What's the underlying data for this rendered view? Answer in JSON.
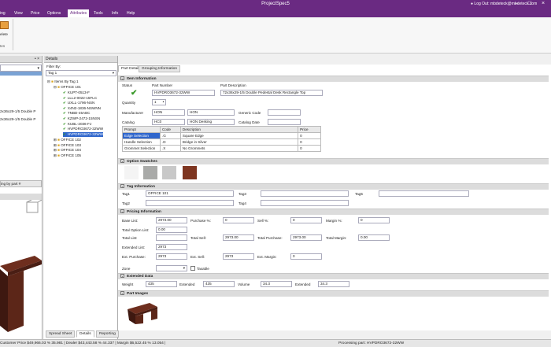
{
  "window": {
    "title": "ProjectSpec5",
    "user": "Log Out: mbdeteck@mbdeteck.com"
  },
  "menu": [
    "ing",
    "View",
    "Price",
    "Options",
    "Attributes",
    "Tools",
    "Info",
    "Help"
  ],
  "ribbon": {
    "button_label": "elete",
    "group_label": "tes"
  },
  "left": {
    "tree_items": [
      "2x36x29-1/5 Double P",
      "2x36x29-1/5 Double P"
    ],
    "group_by": "ing by part #"
  },
  "details": {
    "label": "Details",
    "filter_label": "Filter By:",
    "filter_value": "Tag 1"
  },
  "tree": {
    "root": "Items By Tag 1",
    "office101": "OFFICE 101",
    "parts": [
      "KUPT-0513-F",
      "LLL2-0022-15FLC",
      "UXLL-1796-NSN",
      "X4N2-1836-NSWNN",
      "TNBD-45ABC",
      "KZWP-2472-15NSN",
      "KUBL-2036-FJ",
      "HVPDRO3672-32WW",
      "HVPDRO3672-32WW"
    ],
    "offices": [
      "OFFICE 102",
      "OFFICE 103",
      "OFFICE 104",
      "OFFICE 105"
    ]
  },
  "tabs": [
    "Part Details",
    "Grouping Information"
  ],
  "item_info": {
    "section": "Item Information",
    "status_label": "Status",
    "part_number_label": "Part Number",
    "part_description_label": "Part Description",
    "part_number": "HVPDRO3672-32WW",
    "part_description": "72x36x29-1/5 Double Pedestal Desk  Rectangle Top",
    "quantity_label": "Quantity",
    "quantity": "1",
    "manufacturer_label": "Manufacturer",
    "manufacturer_code": "HON",
    "manufacturer_name": "HON",
    "generic_code_label": "Generic Code",
    "catalog_label": "Catalog",
    "catalog_code": "HC0",
    "catalog_name": "HON Desking",
    "catalog_date_label": "Catalog Date"
  },
  "prompts": {
    "headers": [
      "Prompt",
      "Code",
      "Description",
      "Price"
    ],
    "rows": [
      [
        "Edge Selection",
        ".G",
        "Square Edge",
        "0"
      ],
      [
        "Handle Selection",
        ".D",
        "Bridge in Silver",
        "0"
      ],
      [
        "Grommet Selection",
        ".X",
        "No Grommets",
        "0"
      ]
    ]
  },
  "option_swatches": {
    "section": "Option Swatches",
    "colors": [
      "#f4f4f4",
      "#a9aaa8",
      "#c8c8c8",
      "#7e3520"
    ]
  },
  "tag_info": {
    "section": "Tag Information",
    "tag1_label": "Tag1",
    "tag1": "OFFICE 101",
    "tag2_label": "Tag2",
    "tag3_label": "Tag3",
    "tag4_label": "Tag4",
    "tag5_label": "Tag5"
  },
  "pricing": {
    "section": "Pricing Information",
    "base_list_label": "Base List:",
    "base_list": "2973.00",
    "purchase_pct_label": "Purchase %:",
    "purchase_pct": "0",
    "sell_pct_label": "Sell %:",
    "sell_pct": "0",
    "margin_pct_label": "Margin %:",
    "margin_pct": "0",
    "total_option_list_label": "Total Option List:",
    "total_option_list": "0.00",
    "total_list_label": "Total List:",
    "total_sell_label": "Total Sell:",
    "total_sell": "2973.00",
    "total_purchase_label": "Total Purchase:",
    "total_purchase": "2973.00",
    "total_margin_label": "Total Margin:",
    "total_margin": "0.00",
    "extended_list_label": "Extended List:",
    "extended_list": "2973",
    "ext_purchase_label": "Ext. Purchase:",
    "ext_purchase": "2973",
    "ext_sell_label": "Ext. Sell:",
    "ext_sell": "2973",
    "ext_margin_label": "Ext. Margin:",
    "ext_margin": "0",
    "zone_label": "Zone",
    "taxable_label": "Taxable"
  },
  "extended_data": {
    "section": "Extended Data",
    "weight_label": "Weight",
    "weight": "435",
    "extended1_label": "Extended",
    "extended1": "435",
    "volume_label": "Volume",
    "volume": "34.3",
    "extended2_label": "Extended",
    "extended2": "34.3"
  },
  "part_images": {
    "section": "Part Images"
  },
  "bottom_tabs": [
    "Spread Sheet",
    "Details",
    "Reporting"
  ],
  "status": {
    "left": "Customer Price  $49,966.03  %  35.981  |  Dealer  $43,443.58  %  44.337  |  Margin  $6,522.45  %  13.054  |",
    "right": "Processing part: HVPDRO3672-32WW"
  },
  "colors": {
    "title_bar": "#6a2a82",
    "selected_row": "#2f66cc",
    "status_check": "#3a9a2a"
  }
}
